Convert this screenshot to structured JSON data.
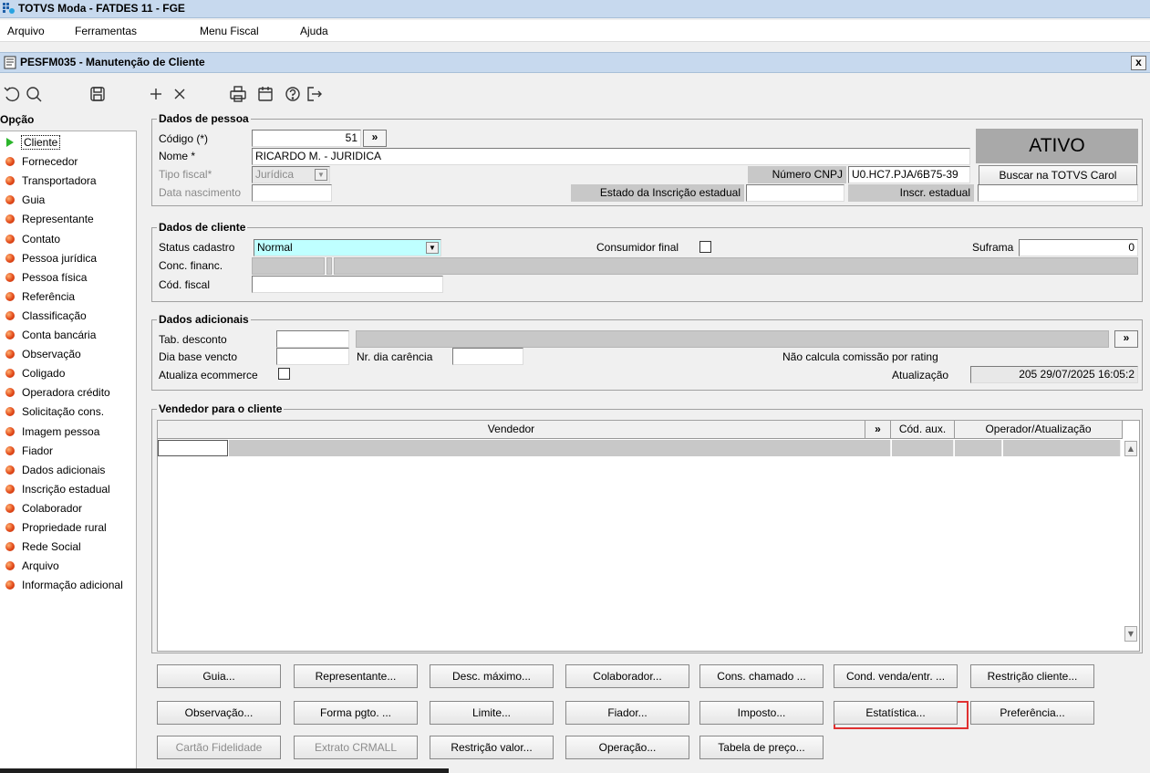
{
  "window": {
    "title": "TOTVS Moda - FATDES 11 - FGE"
  },
  "menu": [
    "Arquivo",
    "Ferramentas",
    "Menu Fiscal",
    "Ajuda"
  ],
  "inner": {
    "title": "PESFM035 - Manutenção de Cliente",
    "close": "x"
  },
  "toolbar": [
    "undo-icon",
    "search-icon",
    "save-icon",
    "add-icon",
    "delete-icon",
    "print-icon",
    "calendar-icon",
    "help-icon",
    "exit-icon"
  ],
  "options": {
    "title": "Opção",
    "items": [
      "Cliente",
      "Fornecedor",
      "Transportadora",
      "Guia",
      "Representante",
      "Contato",
      "Pessoa jurídica",
      "Pessoa física",
      "Referência",
      "Classificação",
      "Conta bancária",
      "Observação",
      "Coligado",
      "Operadora crédito",
      "Solicitação cons.",
      "Imagem pessoa",
      "Fiador",
      "Dados adicionais",
      "Inscrição estadual",
      "Colaborador",
      "Propriedade rural",
      "Rede Social",
      "Arquivo",
      "Informação adicional"
    ]
  },
  "pessoa": {
    "title": "Dados de pessoa",
    "codigo_label": "Código (*)",
    "codigo_value": "51",
    "nome_label": "Nome *",
    "nome_value": "RICARDO M. - JURIDICA",
    "tipo_label": "Tipo fiscal*",
    "tipo_value": "Jurídica",
    "nasc_label": "Data nascimento",
    "status": "ATIVO",
    "cnpj_label": "Número CNPJ",
    "cnpj_value": "U0.HC7.PJA/6B75-39",
    "buscar": "Buscar na TOTVS Carol",
    "estado_insc_label": "Estado da Inscrição estadual",
    "insc_label": "Inscr. estadual",
    "more": "»"
  },
  "cliente": {
    "title": "Dados de cliente",
    "status_label": "Status cadastro",
    "status_value": "Normal",
    "consumidor_label": "Consumidor final",
    "suframa_label": "Suframa",
    "suframa_value": "0",
    "conc_label": "Conc. financ.",
    "fiscal_label": "Cód. fiscal"
  },
  "adicionais": {
    "title": "Dados adicionais",
    "tab_label": "Tab. desconto",
    "dia_label": "Dia base vencto",
    "carencia_label": "Nr. dia carência",
    "comissao_label": "Não calcula comissão por rating",
    "ecom_label": "Atualiza ecommerce",
    "atual_label": "Atualização",
    "atual_value": "205 29/07/2025 16:05:2",
    "more": "»"
  },
  "vendedor": {
    "title": "Vendedor para o cliente",
    "columns": [
      "Vendedor",
      "»",
      "Cód. aux.",
      "Operador/Atualização"
    ]
  },
  "buttons": {
    "row1": [
      "Guia...",
      "Representante...",
      "Desc. máximo...",
      "Colaborador...",
      "Cons. chamado ...",
      "Cond. venda/entr. ...",
      "Restrição cliente..."
    ],
    "row2": [
      "Observação...",
      "Forma pgto. ...",
      "Limite...",
      "Fiador...",
      "Imposto...",
      "Estatística...",
      "Preferência..."
    ],
    "row3": [
      "Cartão Fidelidade",
      "Extrato CRMALL",
      "Restrição valor...",
      "Operação...",
      "Tabela de preço..."
    ]
  },
  "colors": {
    "titlebar": "#c7d9ee",
    "status_bg": "#a9a9a9",
    "highlight": "#e03030",
    "status_field": "#bfffff"
  }
}
